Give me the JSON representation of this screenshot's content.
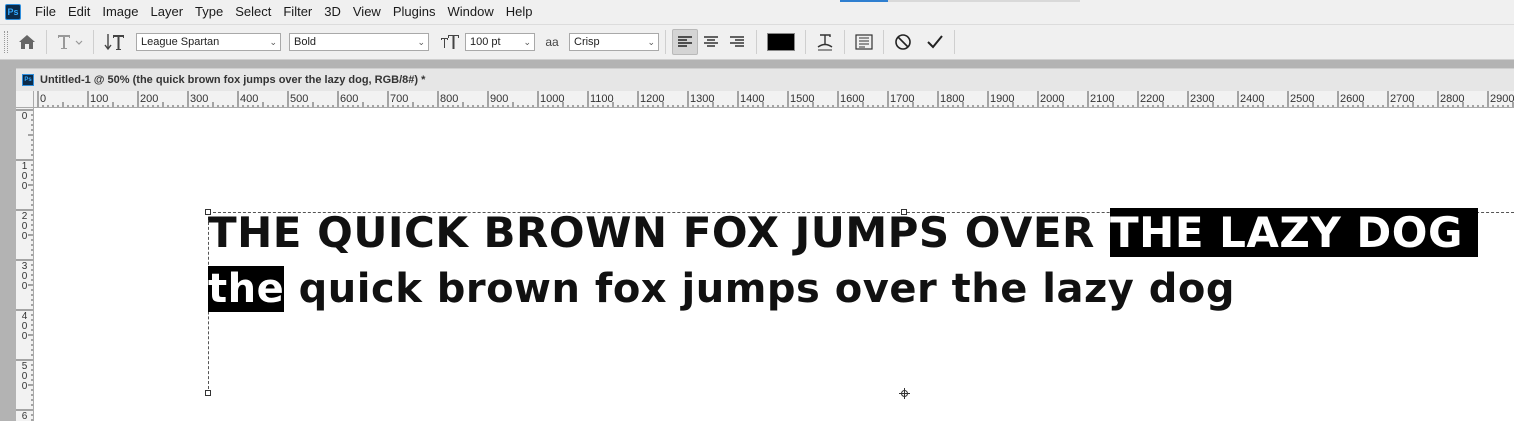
{
  "menubar": {
    "items": [
      "File",
      "Edit",
      "Image",
      "Layer",
      "Type",
      "Select",
      "Filter",
      "3D",
      "View",
      "Plugins",
      "Window",
      "Help"
    ],
    "logo_text": "Ps"
  },
  "options": {
    "font_family": "League Spartan",
    "font_style": "Bold",
    "font_size": "100 pt",
    "antialias_icon": "aa",
    "antialias": "Crisp",
    "text_color": "#000000"
  },
  "document": {
    "icon_text": "Ps",
    "title": "Untitled-1 @ 50% (the quick brown fox jumps over the lazy dog, RGB/8#) *"
  },
  "rulers": {
    "horizontal": [
      "0",
      "100",
      "200",
      "300",
      "400",
      "500",
      "600",
      "700",
      "800",
      "900",
      "1000",
      "1100",
      "1200",
      "1300",
      "1400",
      "1500",
      "1600",
      "1700",
      "1800",
      "1900",
      "2000",
      "2100",
      "2200",
      "2300",
      "2400",
      "2500",
      "2600",
      "2700",
      "2800",
      "2900"
    ],
    "vertical": [
      "0",
      "1\n0\n0",
      "2\n0\n0",
      "3\n0\n0",
      "4\n0\n0",
      "5\n0\n0",
      "6"
    ]
  },
  "canvas": {
    "line1_plain": "THE QUICK BROWN FOX JUMPS OVER ",
    "line1_selected": "THE LAZY DOG ",
    "line2_selected": "the",
    "line2_plain": " quick brown fox jumps over the lazy dog"
  }
}
